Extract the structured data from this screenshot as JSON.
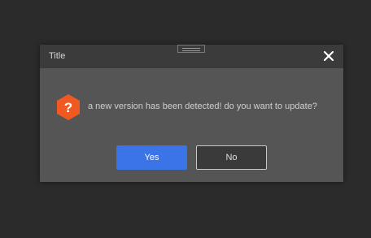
{
  "dialog": {
    "title": "Title",
    "message": "a new version has been detected! do you want to update?",
    "icon": "question-icon",
    "buttons": {
      "yes_label": "Yes",
      "no_label": "No"
    }
  },
  "colors": {
    "background": "#2b2b2b",
    "dialog_body": "#555555",
    "titlebar": "#3b3b3b",
    "primary_button": "#3b74e6",
    "icon_orange": "#f05a22"
  }
}
